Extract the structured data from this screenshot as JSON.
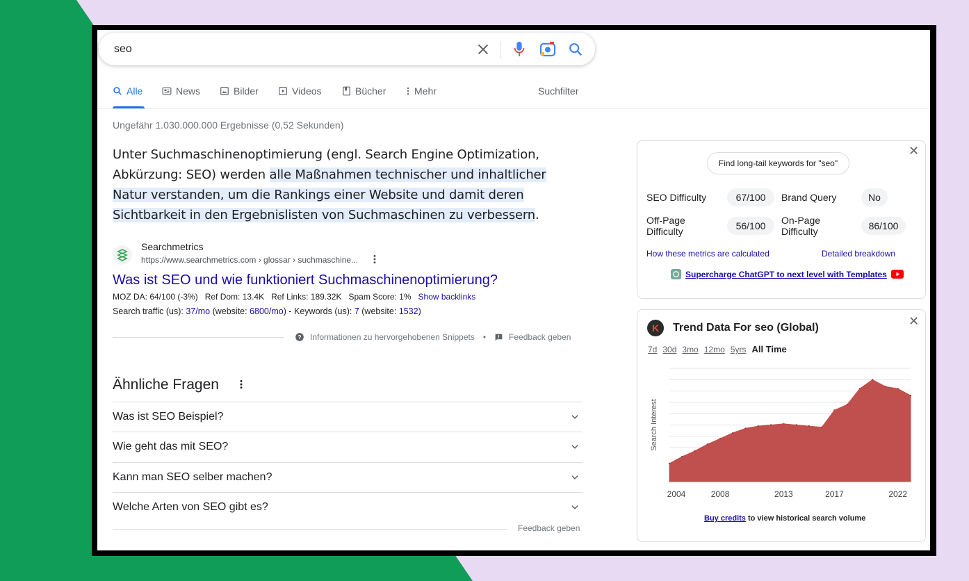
{
  "search": {
    "query": "seo"
  },
  "tabs": [
    {
      "label": "Alle",
      "icon": "search-icon"
    },
    {
      "label": "News",
      "icon": "news-icon"
    },
    {
      "label": "Bilder",
      "icon": "image-icon"
    },
    {
      "label": "Videos",
      "icon": "play-icon"
    },
    {
      "label": "Bücher",
      "icon": "book-icon"
    },
    {
      "label": "Mehr",
      "icon": "more-vert-icon"
    }
  ],
  "tools_label": "Suchfilter",
  "results_count": "Ungefähr 1.030.000.000 Ergebnisse (0,52 Sekunden)",
  "snippet": {
    "part1": "Unter Suchmaschinenoptimierung (engl. Search Engine Optimization, Abkürzung: SEO) werden ",
    "highlight": "alle Maßnahmen technischer und inhaltlicher Natur verstanden, um die Rankings einer Website und damit deren Sichtbarkeit in den Ergebnislisten von Suchmaschinen zu verbessern",
    "part2": "."
  },
  "source": {
    "name": "Searchmetrics",
    "url": "https://www.searchmetrics.com › glossar › suchmaschine...",
    "title": "Was ist SEO und wie funktioniert Suchmaschinenoptimierung?",
    "moz": "MOZ DA: 64/100 (-3%)   Ref Dom: 13.4K   Ref Links: 189.32K   Spam Score: 1%",
    "show_backlinks": "Show backlinks",
    "traffic_prefix": "Search traffic (us): ",
    "traffic_value": "37/mo",
    "traffic_website_prefix": " (website: ",
    "traffic_website": "6800/mo",
    "keywords_prefix": ") - Keywords (us): ",
    "keywords_value": "7",
    "keywords_website_prefix": " (website: ",
    "keywords_website": "1532",
    "suffix": ")"
  },
  "snippet_info": "Informationen zu hervorgehobenen Snippets",
  "bullet": "•",
  "feedback": "Feedback geben",
  "paa": {
    "title": "Ähnliche Fragen",
    "questions": [
      "Was ist SEO Beispiel?",
      "Wie geht das mit SEO?",
      "Kann man SEO selber machen?",
      "Welche Arten von SEO gibt es?"
    ],
    "feedback": "Feedback geben"
  },
  "kw_panel": {
    "button": "Find long-tail keywords for \"seo\"",
    "seo_difficulty_label": "SEO Difficulty",
    "seo_difficulty": "67/100",
    "brand_query_label": "Brand Query",
    "brand_query": "No",
    "offpage_label_1": "Off-Page",
    "offpage_label_2": "Difficulty",
    "offpage": "56/100",
    "onpage_label_1": "On-Page",
    "onpage_label_2": "Difficulty",
    "onpage": "86/100",
    "metrics_link": "How these metrics are calculated",
    "breakdown_link": "Detailed breakdown",
    "chatgpt_link": "Supercharge ChatGPT to next level with Templates"
  },
  "trend": {
    "logo_letter": "K",
    "title": "Trend Data For seo (Global)",
    "ranges": [
      "7d",
      "30d",
      "3mo",
      "12mo",
      "5yrs"
    ],
    "active_range": "All Time",
    "ylabel": "Search Interest",
    "xticks": [
      "2004",
      "2008",
      "2013",
      "2017",
      "2022"
    ],
    "buy_credits": "Buy credits",
    "buy_suffix": " to view historical search volume"
  },
  "colors": {
    "link": "#1a0dab",
    "accent": "#1a73e8",
    "chart": "#c0504d",
    "green_bg": "#0f9d58",
    "lilac_bg": "#e8daf3"
  },
  "chart_data": {
    "type": "area",
    "ylabel": "Search Interest",
    "x": [
      2004,
      2005,
      2006,
      2007,
      2008,
      2009,
      2010,
      2011,
      2012,
      2013,
      2014,
      2015,
      2016,
      2017,
      2018,
      2019,
      2020,
      2021,
      2022,
      2023
    ],
    "series": [
      {
        "values": [
          16,
          22,
          27,
          33,
          38,
          43,
          47,
          49,
          50,
          51,
          50,
          49,
          48,
          63,
          68,
          82,
          90,
          84,
          82,
          76
        ]
      }
    ],
    "xlabel_ticks": [
      "2004",
      "2008",
      "2013",
      "2017",
      "2022"
    ],
    "ylim": [
      0,
      100
    ],
    "grid": true
  }
}
